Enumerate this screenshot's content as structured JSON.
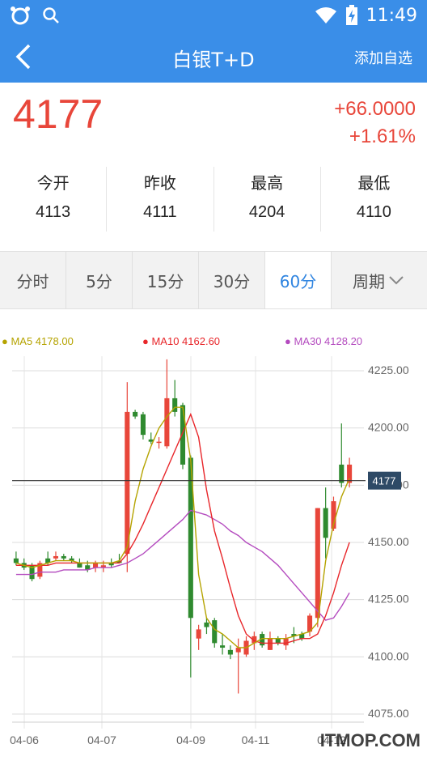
{
  "status": {
    "time": "11:49"
  },
  "header": {
    "title": "白银T+D",
    "action": "添加自选"
  },
  "quote": {
    "price": "4177",
    "change": "+66.0000",
    "change_pct": "+1.61%",
    "stats": [
      {
        "label": "今开",
        "value": "4113"
      },
      {
        "label": "昨收",
        "value": "4111"
      },
      {
        "label": "最高",
        "value": "4204"
      },
      {
        "label": "最低",
        "value": "4110"
      }
    ]
  },
  "tabs": [
    "分时",
    "5分",
    "15分",
    "30分",
    "60分",
    "周期"
  ],
  "active_tab": "60分",
  "legend": {
    "ma5": "MA5 4178.00",
    "ma10": "MA10 4162.60",
    "ma30": "MA30 4128.20"
  },
  "watermark": "ITMOP.COM",
  "colors": {
    "accent": "#3a8ee8",
    "up": "#e8463a",
    "down": "#2f8a2f",
    "ma5": "#b5a300",
    "ma10": "#e8262a",
    "ma30": "#b44bbf"
  },
  "chart_data": {
    "type": "candlestick",
    "x_labels": [
      "04-06",
      "04-07",
      "04-09",
      "04-11",
      "04-12"
    ],
    "y_ticks": [
      "4225.00",
      "4200.00",
      "4175.00",
      "4150.00",
      "4125.00",
      "4100.00",
      "4075.00"
    ],
    "ylim": [
      4075,
      4225
    ],
    "last_price_label": "4177",
    "last_price": 4177,
    "candles": [
      [
        4143,
        4146,
        4140,
        4141
      ],
      [
        4141,
        4143,
        4138,
        4139
      ],
      [
        4140,
        4141,
        4133,
        4134
      ],
      [
        4135,
        4142,
        4134,
        4141
      ],
      [
        4143,
        4146,
        4140,
        4141
      ],
      [
        4143,
        4146,
        4142,
        4144
      ],
      [
        4144,
        4145,
        4142,
        4143
      ],
      [
        4143,
        4144,
        4141,
        4142
      ],
      [
        4141,
        4143,
        4139,
        4139
      ],
      [
        4140,
        4142,
        4137,
        4138
      ],
      [
        4139,
        4142,
        4137,
        4141
      ],
      [
        4139,
        4142,
        4137,
        4140
      ],
      [
        4141,
        4143,
        4139,
        4140
      ],
      [
        4142,
        4145,
        4141,
        4141
      ],
      [
        4145,
        4220,
        4137,
        4207
      ],
      [
        4207,
        4208,
        4204,
        4205
      ],
      [
        4206,
        4207,
        4195,
        4197
      ],
      [
        4195,
        4198,
        4193,
        4194
      ],
      [
        4194,
        4196,
        4191,
        4194
      ],
      [
        4192,
        4230,
        4191,
        4213
      ],
      [
        4213,
        4221,
        4205,
        4207
      ],
      [
        4210,
        4211,
        4182,
        4184
      ],
      [
        4187,
        4188,
        4091,
        4117
      ],
      [
        4108,
        4114,
        4103,
        4112
      ],
      [
        4115,
        4117,
        4110,
        4113
      ],
      [
        4116,
        4117,
        4104,
        4106
      ],
      [
        4105,
        4110,
        4101,
        4104
      ],
      [
        4103,
        4105,
        4099,
        4101
      ],
      [
        4102,
        4108,
        4084,
        4104
      ],
      [
        4101,
        4109,
        4100,
        4107
      ],
      [
        4106,
        4111,
        4103,
        4109
      ],
      [
        4110,
        4111,
        4104,
        4105
      ],
      [
        4103,
        4111,
        4103,
        4108
      ],
      [
        4108,
        4109,
        4105,
        4106
      ],
      [
        4105,
        4110,
        4103,
        4108
      ],
      [
        4110,
        4113,
        4106,
        4109
      ],
      [
        4110,
        4111,
        4107,
        4108
      ],
      [
        4111,
        4119,
        4109,
        4118
      ],
      [
        4117,
        4165,
        4113,
        4165
      ],
      [
        4165,
        4174,
        4143,
        4152
      ],
      [
        4156,
        4170,
        4155,
        4168
      ],
      [
        4184,
        4202,
        4174,
        4176
      ],
      [
        4176,
        4187,
        4174,
        4184
      ]
    ],
    "ma5": [
      4141,
      4140,
      4139,
      4140,
      4141,
      4142,
      4142,
      4142,
      4141,
      4141,
      4141,
      4141,
      4141,
      4142,
      4148,
      4168,
      4182,
      4192,
      4200,
      4205,
      4209,
      4209,
      4186,
      4136,
      4117,
      4112,
      4110,
      4107,
      4104,
      4104,
      4106,
      4108,
      4108,
      4108,
      4108,
      4109,
      4110,
      4111,
      4115,
      4142,
      4158,
      4170,
      4178
    ],
    "ma10": [
      4140,
      4140,
      4140,
      4140,
      4140,
      4141,
      4141,
      4141,
      4141,
      4141,
      4141,
      4141,
      4141,
      4141,
      4145,
      4151,
      4158,
      4166,
      4174,
      4182,
      4190,
      4198,
      4206,
      4196,
      4173,
      4155,
      4143,
      4130,
      4118,
      4110,
      4107,
      4106,
      4106,
      4106,
      4106,
      4107,
      4108,
      4108,
      4110,
      4118,
      4128,
      4140,
      4150
    ],
    "ma30": [
      4136,
      4136,
      4136,
      4137,
      4137,
      4137,
      4138,
      4138,
      4138,
      4138,
      4139,
      4139,
      4139,
      4140,
      4141,
      4143,
      4145,
      4148,
      4151,
      4154,
      4157,
      4160,
      4164,
      4163,
      4162,
      4160,
      4158,
      4155,
      4153,
      4150,
      4148,
      4146,
      4143,
      4140,
      4136,
      4132,
      4128,
      4124,
      4120,
      4116,
      4117,
      4122,
      4128
    ]
  }
}
